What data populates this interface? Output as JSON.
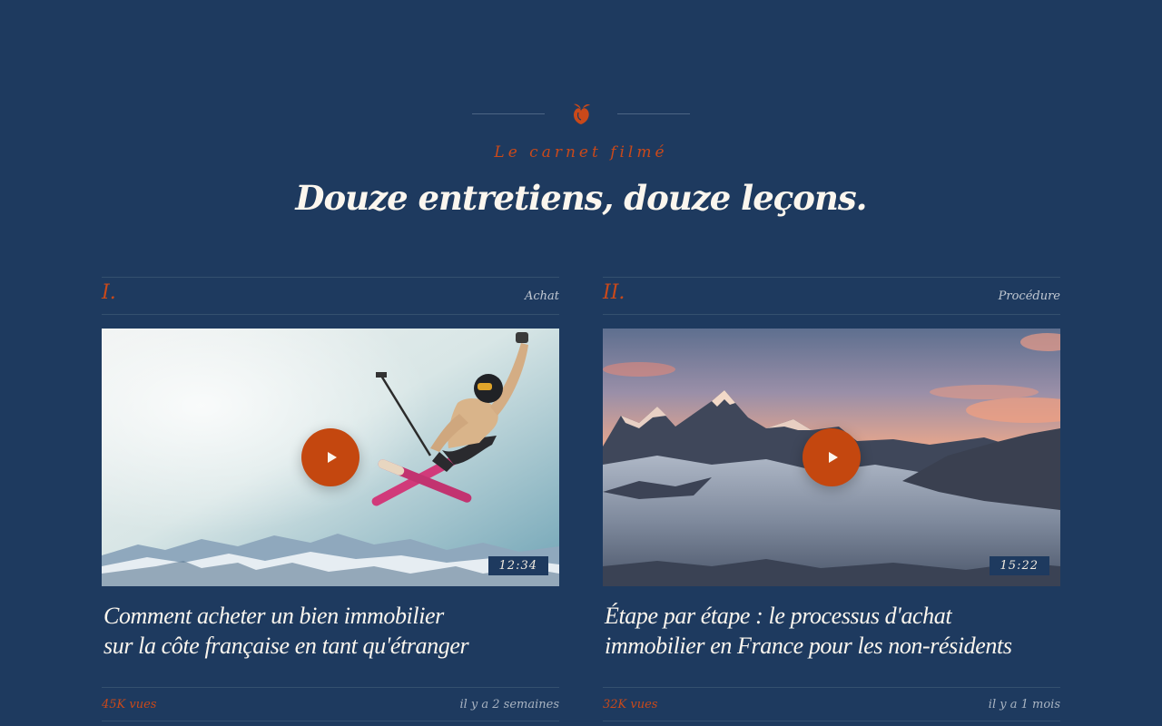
{
  "section": {
    "eyebrow": "Le carnet filmé",
    "title": "Douze entretiens, douze leçons."
  },
  "colors": {
    "background": "#1e3a5f",
    "accent": "#c9491a",
    "text": "#fbf6ee"
  },
  "videos": [
    {
      "numeral": "I.",
      "category": "Achat",
      "thumbnail": "freestyle-skier-mountain-scene",
      "duration": "12:34",
      "title_line1": "Comment acheter un bien immobilier",
      "title_line2": "sur la côte française en tant qu'étranger",
      "views": "45K vues",
      "age": "il y a 2 semaines"
    },
    {
      "numeral": "II.",
      "category": "Procédure",
      "thumbnail": "alpine-sunset-sea-of-clouds-scene",
      "duration": "15:22",
      "title_line1": "Étape par étape : le processus d'achat",
      "title_line2": "immobilier en France pour les non-résidents",
      "views": "32K vues",
      "age": "il y a 1 mois"
    }
  ],
  "icons": {
    "ornament": "fleuron-icon",
    "play": "play-icon"
  }
}
